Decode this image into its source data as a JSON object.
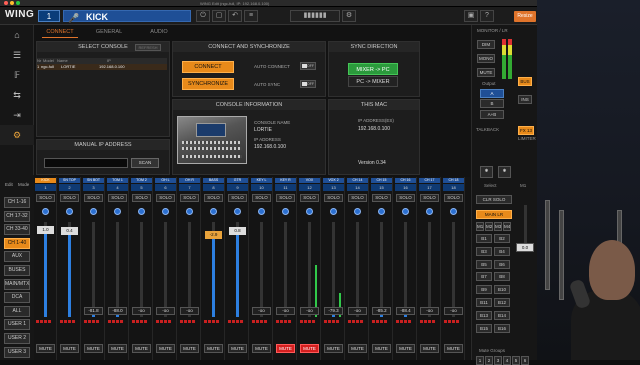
{
  "window": {
    "title": "WING Edit (ngc-full, IP: 192.168.0.100)"
  },
  "topbar": {
    "logo": "WING",
    "ch_number": "1",
    "ch_name": "KICK",
    "resize": "Resize"
  },
  "nav": [
    "home-icon",
    "sliders-icon",
    "fx-icon",
    "routing-icon",
    "import-icon",
    "settings-icon"
  ],
  "tabs": [
    "CONNECT",
    "GENERAL",
    "AUDIO"
  ],
  "select_console": {
    "title": "SELECT CONSOLE",
    "refresh": "REFRESH",
    "cols": [
      "Nr",
      "Model",
      "Name",
      "IP"
    ],
    "row": {
      "nr": "1",
      "model": "ngc-full",
      "name": "LORTIE",
      "ip": "192.168.0.100"
    }
  },
  "connect": {
    "title": "CONNECT AND SYNCHRONIZE",
    "connect_btn": "CONNECT",
    "sync_btn": "SYNCHRONIZE",
    "auto_connect": "AUTO CONNECT",
    "auto_sync": "AUTO SYNC",
    "toggle": "OFF"
  },
  "direction": {
    "title": "SYNC DIRECTION",
    "mixer_pc": "MIXER -> PC",
    "pc_mixer": "PC -> MIXER"
  },
  "manual": {
    "title": "MANUAL IP ADDRESS",
    "scan": "SCAN"
  },
  "console_info": {
    "title": "CONSOLE INFORMATION",
    "name_label": "CONSOLE NAME",
    "name": "LORTIE",
    "ip_label": "IP ADDRESS",
    "ip": "192.168.0.100"
  },
  "this_mac": {
    "title": "THIS MAC",
    "ip_label": "IP ADDRESS(ES)",
    "ip": "192.168.0.100",
    "version": "Version 0.34"
  },
  "bank": [
    "CH 1-16",
    "CH 17-32",
    "CH 33-40",
    "CH 1-40",
    "AUX",
    "BUSES",
    "MAIN/MTX",
    "DCA",
    "ALL",
    "USER 1",
    "USER 2",
    "USER 3"
  ],
  "bank_top": [
    "Edit",
    "Mode"
  ],
  "strips": [
    {
      "name": "KICK",
      "nr": "1",
      "color": "#2d7fe0",
      "fader": "1.0",
      "level": 0.92,
      "meter": 0.0,
      "mute": false,
      "sel": true
    },
    {
      "name": "SN TOP",
      "nr": "2",
      "color": "#2d7fe0",
      "fader": "0.4",
      "level": 0.9,
      "meter": 0.0,
      "mute": false,
      "sel": false
    },
    {
      "name": "SN BOT",
      "nr": "3",
      "color": "#2d7fe0",
      "fader": "-81.8",
      "level": 0.07,
      "meter": 0.0,
      "mute": false,
      "sel": false
    },
    {
      "name": "TOM 1",
      "nr": "4",
      "color": "#2d7fe0",
      "fader": "-88.0",
      "level": 0.05,
      "meter": 0.0,
      "mute": false,
      "sel": false
    },
    {
      "name": "TOM 2",
      "nr": "5",
      "color": "#2d7fe0",
      "fader": "-oo",
      "level": 0.0,
      "meter": 0.0,
      "mute": false,
      "sel": false
    },
    {
      "name": "OH L",
      "nr": "6",
      "color": "#2d7fe0",
      "fader": "-oo",
      "level": 0.0,
      "meter": 0.0,
      "mute": false,
      "sel": false
    },
    {
      "name": "OH R",
      "nr": "7",
      "color": "#2d7fe0",
      "fader": "-oo",
      "level": 0.0,
      "meter": 0.0,
      "mute": false,
      "sel": false
    },
    {
      "name": "BASS",
      "nr": "8",
      "color": "#2d7fe0",
      "fader": "-2.9",
      "level": 0.86,
      "meter": 0.0,
      "mute": false,
      "sel": false
    },
    {
      "name": "GTR",
      "nr": "9",
      "color": "#2d7fe0",
      "fader": "0.8",
      "level": 0.91,
      "meter": 0.0,
      "mute": false,
      "sel": false
    },
    {
      "name": "KEY L",
      "nr": "10",
      "color": "#2d7fe0",
      "fader": "-oo",
      "level": 0.0,
      "meter": 0.0,
      "mute": false,
      "sel": false
    },
    {
      "name": "KEY R",
      "nr": "11",
      "color": "#2d7fe0",
      "fader": "-oo",
      "level": 0.0,
      "meter": 0.0,
      "mute": true,
      "sel": false
    },
    {
      "name": "VOX",
      "nr": "12",
      "color": "#2d7fe0",
      "fader": "-oo",
      "level": 0.0,
      "meter": 0.55,
      "mute": true,
      "sel": false
    },
    {
      "name": "VOX 2",
      "nr": "13",
      "color": "#2d7fe0",
      "fader": "-79.3",
      "level": 0.08,
      "meter": 0.25,
      "mute": false,
      "sel": false
    },
    {
      "name": "CH 14",
      "nr": "14",
      "color": "#2d7fe0",
      "fader": "-oo",
      "level": 0.0,
      "meter": 0.0,
      "mute": false,
      "sel": false
    },
    {
      "name": "CH 15",
      "nr": "15",
      "color": "#2d7fe0",
      "fader": "-85.2",
      "level": 0.06,
      "meter": 0.0,
      "mute": false,
      "sel": false
    },
    {
      "name": "CH 16",
      "nr": "16",
      "color": "#2d7fe0",
      "fader": "-88.4",
      "level": 0.05,
      "meter": 0.0,
      "mute": false,
      "sel": false
    },
    {
      "name": "CH 17",
      "nr": "17",
      "color": "#2d7fe0",
      "fader": "-oo",
      "level": 0.0,
      "meter": 0.0,
      "mute": false,
      "sel": false
    },
    {
      "name": "CH 18",
      "nr": "18",
      "color": "#2d7fe0",
      "fader": "-oo",
      "level": 0.0,
      "meter": 0.0,
      "mute": false,
      "sel": false
    }
  ],
  "strip_labels": {
    "solo": "SOLO",
    "mute": "MUTE"
  },
  "monitor": {
    "title": "MONITOR / LR",
    "dim": "DIM",
    "mono": "MONO",
    "mute": "MUTE",
    "output": "Output",
    "a": "A",
    "b": "B",
    "ab": "A+B",
    "bus": "BUS",
    "ins": "INS",
    "talkback": "TALKBACK",
    "fx": "FX 13",
    "limiter": "LIMITER",
    "select": "Select",
    "m1": "M1",
    "clr": "CLR SOLO",
    "main": "MAIN LR",
    "mains": [
      "M1",
      "M2",
      "M3",
      "M4"
    ],
    "fader": "0.0",
    "buses": [
      "B1",
      "B2",
      "B3",
      "B4",
      "B5",
      "B6",
      "B7",
      "B8",
      "B9",
      "B10",
      "B11",
      "B12",
      "B13",
      "B14",
      "B15",
      "B16"
    ],
    "mute_groups": "Mute Groups",
    "mg": [
      "1",
      "2",
      "3",
      "4",
      "5",
      "6"
    ]
  }
}
